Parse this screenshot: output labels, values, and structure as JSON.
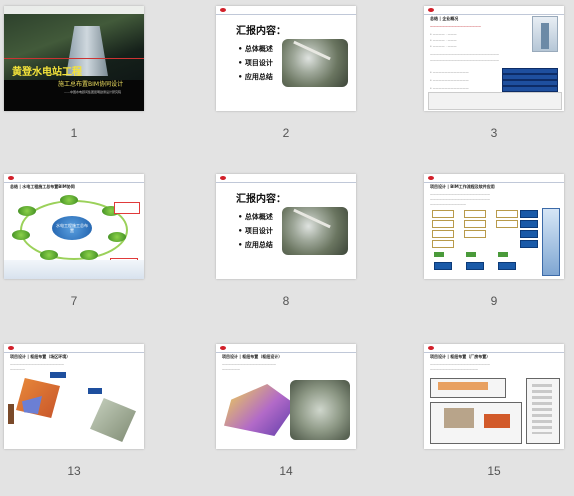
{
  "slides": [
    {
      "number": "1",
      "title": "黄登水电站工程",
      "subtitle": "施工总布置BIM协同设计",
      "caption": "——中国水电顾问集团昆明勘测设计研究院"
    },
    {
      "number": "2",
      "title": "汇报内容：",
      "items": [
        "总体概述",
        "项目设计",
        "应用总结"
      ]
    },
    {
      "number": "3",
      "section": "总结 | 企业概况"
    },
    {
      "number": "7",
      "section": "总结 | 水电工程施工总布置BIM协同",
      "center_label": "水电工程施工总布置"
    },
    {
      "number": "8",
      "title": "汇报内容：",
      "items": [
        "总体概述",
        "项目设计",
        "应用总结"
      ]
    },
    {
      "number": "9",
      "section": "项目设计 | BIM工作流程及软件应用"
    },
    {
      "number": "13",
      "section": "项目设计 | 枢纽布置（场区环境）"
    },
    {
      "number": "14",
      "section": "项目设计 | 枢纽布置（枢纽设计）"
    },
    {
      "number": "15",
      "section": "项目设计 | 枢纽布置（厂房布置）"
    }
  ],
  "colors": {
    "page_background": "#e3e3e3",
    "title_yellow": "#f3e23a",
    "accent_blue": "#1e4f9e",
    "accent_red": "#c0202a",
    "accent_green": "#8cd14a"
  }
}
